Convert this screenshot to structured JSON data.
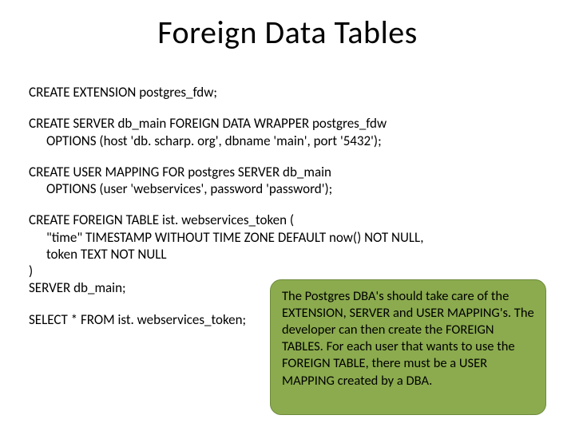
{
  "title": "Foreign Data Tables",
  "sql": {
    "ext": "CREATE EXTENSION postgres_fdw;",
    "server_l1": "CREATE SERVER db_main FOREIGN DATA WRAPPER postgres_fdw",
    "server_l2": "OPTIONS (host 'db. scharp. org', dbname 'main', port '5432');",
    "usermap_l1": "CREATE USER MAPPING FOR postgres SERVER db_main",
    "usermap_l2": "OPTIONS (user 'webservices', password 'password');",
    "ftable_l1": "CREATE FOREIGN TABLE ist. webservices_token (",
    "ftable_l2": "\"time\" TIMESTAMP WITHOUT TIME ZONE DEFAULT now() NOT NULL,",
    "ftable_l3": "token TEXT NOT NULL",
    "ftable_l4": ")",
    "ftable_l5": "SERVER db_main;",
    "select": "SELECT * FROM ist. webservices_token;"
  },
  "callout": "The Postgres DBA's should take care of the EXTENSION, SERVER and USER MAPPING's. The developer can then create the FOREIGN TABLES. For each user that wants to use the FOREIGN TABLE, there must be a USER MAPPING created by a DBA."
}
